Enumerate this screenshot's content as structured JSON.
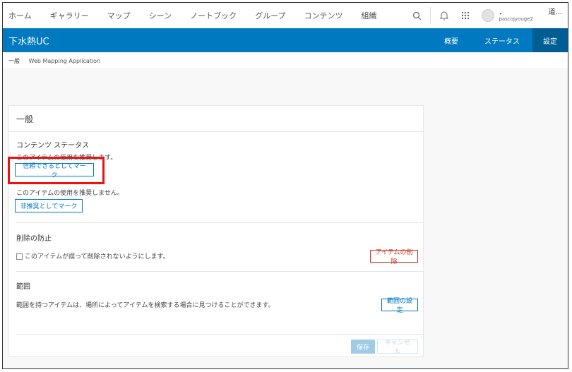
{
  "topnav": {
    "items": [
      "ホーム",
      "ギャラリー",
      "マップ",
      "シーン",
      "ノートブック",
      "グループ",
      "コンテンツ",
      "組織"
    ],
    "search_icon": "search-icon",
    "bell_icon": "bell-icon",
    "apps_icon": "apps-grid-icon",
    "user_dot": "・",
    "username": "pascojyouge2",
    "truncated_name": "道..."
  },
  "header": {
    "title": "下水熱UC",
    "tabs": [
      "概要",
      "ステータス",
      "設定"
    ],
    "active_tab": "設定",
    "color": "#0079c1"
  },
  "breadcrumb": {
    "section": "一般",
    "type": "Web Mapping Application"
  },
  "panel": {
    "title": "一般",
    "content_status": {
      "heading": "コンテンツ ステータス",
      "recommend_text": "このアイテムの使用を推奨します。",
      "trusted_button": "信頼できるとしてマーク",
      "not_recommend_text": "このアイテムの使用を推奨しません。",
      "deprecated_button": "非推奨としてマーク"
    },
    "delete_protection": {
      "heading": "削除の防止",
      "checkbox_label": "このアイテムが誤って削除されないようにします。",
      "delete_button": "アイテムの削除"
    },
    "extent": {
      "heading": "範囲",
      "text": "範囲を持つアイテムは、場所によってアイテムを検索する場合に見つけることができます。",
      "set_button": "範囲の設定"
    },
    "footer": {
      "save": "保存",
      "cancel": "キャンセル"
    }
  },
  "colors": {
    "accent": "#0079c1",
    "danger": "#d83020",
    "highlight": "#e11111"
  }
}
